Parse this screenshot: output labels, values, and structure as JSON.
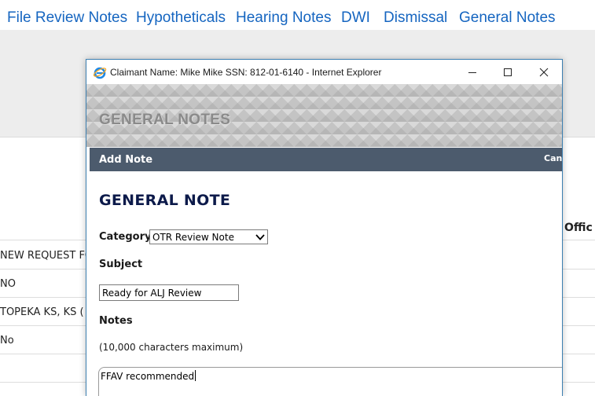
{
  "nav": {
    "tabs": [
      "File Review Notes",
      "Hypotheticals",
      "Hearing Notes",
      "DWI",
      "Dismissal",
      "General Notes"
    ]
  },
  "background": {
    "header_right": "y Offic",
    "rows": [
      "NEW REQUEST FO",
      "NO",
      "TOPEKA KS, KS (",
      "No",
      "",
      ""
    ]
  },
  "popup": {
    "window_title": "Claimant Name: Mike Mike SSN: 812-01-6140 - Internet Explorer",
    "banner_title": "GENERAL NOTES",
    "add_note_label": "Add Note",
    "cancel_label": "Canc",
    "form": {
      "heading": "GENERAL NOTE",
      "category_label": "Category",
      "category_value": "OTR Review Note",
      "subject_label": "Subject",
      "subject_value": "Ready for ALJ Review",
      "notes_label": "Notes",
      "notes_hint": "(10,000 characters maximum)",
      "notes_value": "FFAV recommended"
    }
  },
  "colors": {
    "nav_link": "#1565c0",
    "strip_bg": "#4c5b6d",
    "heading": "#0c1a4a",
    "window_border": "#3c7fb1"
  }
}
